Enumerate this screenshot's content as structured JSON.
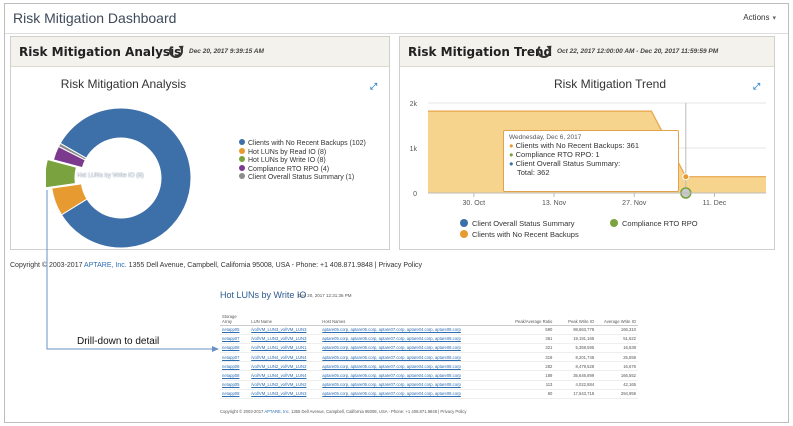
{
  "app": {
    "title": "Risk Mitigation Dashboard",
    "actions_label": "Actions"
  },
  "analysis_panel": {
    "title": "Risk Mitigation Analysis",
    "date": "Dec 20, 2017 9:39:15 AM",
    "chart_title": "Risk Mitigation Analysis",
    "center_label": "Hot LUNs by Write IO (8)"
  },
  "trend_panel": {
    "title": "Risk Mitigation Trend",
    "date": "Oct 22, 2017 12:00:00 AM - Dec 20, 2017 11:59:59 PM",
    "chart_title": "Risk Mitigation Trend",
    "tooltip": {
      "header": "Wednesday, Dec 6, 2017",
      "line1": "Clients with No Recent Backups: 361",
      "line2": "Compliance RTO RPO: 1",
      "line3": "Client Overall Status Summary:",
      "line4": "Total: 362"
    }
  },
  "colors": {
    "blue": "#3d6fa8",
    "orange": "#e79a30",
    "green": "#7aa23f",
    "purple": "#7c3a8e",
    "gray": "#8c8c8c",
    "area": "#f6d48e",
    "area_line": "#e8a449"
  },
  "chart_data": [
    {
      "type": "pie",
      "title": "Risk Mitigation Analysis",
      "series": [
        {
          "name": "Clients with No Recent Backups (102)",
          "value": 102,
          "color": "#3d6fa8"
        },
        {
          "name": "Hot LUNs by Read IO (8)",
          "value": 8,
          "color": "#e79a30"
        },
        {
          "name": "Hot LUNs by Write IO (8)",
          "value": 8,
          "color": "#7aa23f"
        },
        {
          "name": "Compliance RTO RPO (4)",
          "value": 4,
          "color": "#7c3a8e"
        },
        {
          "name": "Client Overall Status Summary (1)",
          "value": 1,
          "color": "#8c8c8c"
        }
      ]
    },
    {
      "type": "area",
      "title": "Risk Mitigation Trend",
      "x_ticks": [
        "30. Oct",
        "13. Nov",
        "27. Nov",
        "11. Dec"
      ],
      "y_ticks": [
        "2k",
        "1k",
        "0"
      ],
      "ylim": [
        0,
        2000
      ],
      "series": [
        {
          "name": "Client Overall Status Summary",
          "color": "#3d6fa8"
        },
        {
          "name": "Compliance RTO RPO",
          "color": "#7aa23f"
        },
        {
          "name": "Clients with No Recent Backups",
          "color": "#e79a30"
        }
      ],
      "points": [
        {
          "x": "2017-10-22",
          "y": 1820
        },
        {
          "x": "2017-11-30",
          "y": 1820
        },
        {
          "x": "2017-12-06",
          "y": 362
        },
        {
          "x": "2017-12-20",
          "y": 362
        }
      ]
    }
  ],
  "copyright": {
    "prefix": "Copyright © 2003-2017",
    "brand": "APTARE, Inc.",
    "suffix": "1355 Dell Avenue, Campbell, California 95008, USA - Phone: +1 408.871.9848 | Privacy Policy"
  },
  "drill_note": "Drill-down to detail",
  "detail": {
    "title": "Hot LUNs by Write IO",
    "date": "Dec 20, 2017 12:31:36 PM",
    "columns": [
      "Storage Array",
      "LUN Name",
      "Host Names",
      "Peak/Average Ratio",
      "Peak Write IO",
      "Average Write IO"
    ],
    "rows": [
      [
        "netapp05",
        "/vol/VM_LUN3_vol/VM_LUN3",
        "aptare05.corp, aptare06.corp, aptare07.corp, aptare04.corp, aptare08.corp",
        "590",
        "98,663,778",
        "166,310"
      ],
      [
        "netapp07",
        "/vol/VM_LUN3_vol/VM_LUN3",
        "aptare05.corp, aptare06.corp, aptare07.corp, aptare04.corp, aptare08.corp",
        "361",
        "19,191,165",
        "51,622"
      ],
      [
        "netapp08",
        "/vol/VM_LUN1_vol/VM_LUN1",
        "aptare05.corp, aptare06.corp, aptare07.corp, aptare04.corp, aptare08.corp",
        "321",
        "5,359,595",
        "16,639"
      ],
      [
        "netapp07",
        "/vol/VM_LUN4_vol/VM_LUN4",
        "aptare05.corp, aptare06.corp, aptare07.corp, aptare04.corp, aptare08.corp",
        "319",
        "8,201,748",
        "25,559"
      ],
      [
        "netapp08",
        "/vol/VM_LUN2_vol/VM_LUN2",
        "aptare05.corp, aptare06.corp, aptare07.corp, aptare04.corp, aptare08.corp",
        "282",
        "8,479,528",
        "16,676"
      ],
      [
        "netapp08",
        "/vol/VM_LUN4_vol/VM_LUN4",
        "aptare05.corp, aptare06.corp, aptare07.corp, aptare04.corp, aptare08.corp",
        "189",
        "35,646,899",
        "166,552"
      ],
      [
        "netapp05",
        "/vol/VM_LUN2_vol/VM_LUN2",
        "aptare05.corp, aptare06.corp, aptare07.corp, aptare04.corp, aptare08.corp",
        "113",
        "4,022,884",
        "42,165"
      ],
      [
        "netapp08",
        "/vol/VM_LUN3_vol/VM_LUN3",
        "aptare05.corp, aptare06.corp, aptare07.corp, aptare04.corp, aptare08.corp",
        "60",
        "17,643,718",
        "294,959"
      ]
    ],
    "footer_prefix": "Copyright © 2003-2017",
    "footer_brand": "APTARE, Inc.",
    "footer_suffix": "1355 Dell Avenue, Campbell, California 95008, USA - Phone: +1 408.871.9848 | Privacy Policy"
  }
}
